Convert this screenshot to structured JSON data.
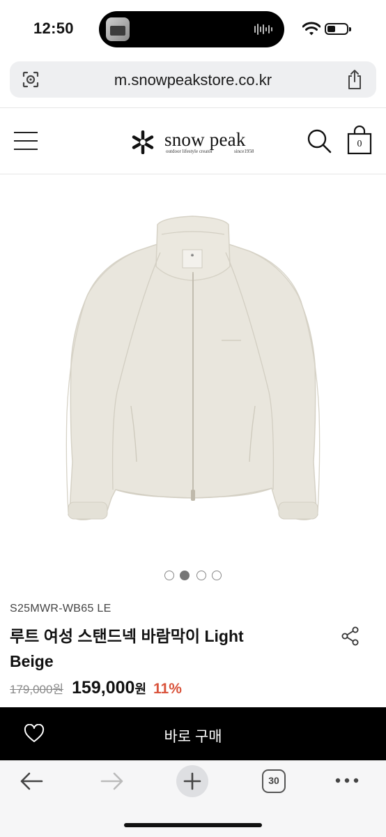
{
  "status_bar": {
    "time": "12:50",
    "icons": [
      "now-playing-thumbnail",
      "audio-waveform-icon",
      "wifi-icon",
      "battery-icon"
    ]
  },
  "browser": {
    "url": "m.snowpeakstore.co.kr",
    "open_tabs": "30",
    "toolbar_icons": [
      "back-arrow-icon",
      "forward-arrow-icon",
      "plus-icon",
      "tabs-icon",
      "more-icon"
    ]
  },
  "header": {
    "brand": "snow peak",
    "brand_tagline": "outdoor lifestyle creator",
    "brand_since": "since1958",
    "cart_count": "0",
    "icons": [
      "menu-icon",
      "snowflake-logo",
      "search-icon",
      "cart-bag-icon"
    ]
  },
  "carousel": {
    "count": 4,
    "active_index": 1
  },
  "product": {
    "code": "S25MWR-WB65 LE",
    "title": "루트 여성 스탠드넥 바람막이 Light Beige",
    "original_price": "179,000원",
    "sale_price": "159,000",
    "currency": "원",
    "discount": "11%"
  },
  "buy_bar": {
    "label": "바로 구매",
    "icon": "heart-icon"
  },
  "colors": {
    "discount": "#d9533b",
    "buy_bar_bg": "#000000",
    "jacket": "#e9e6dd"
  }
}
